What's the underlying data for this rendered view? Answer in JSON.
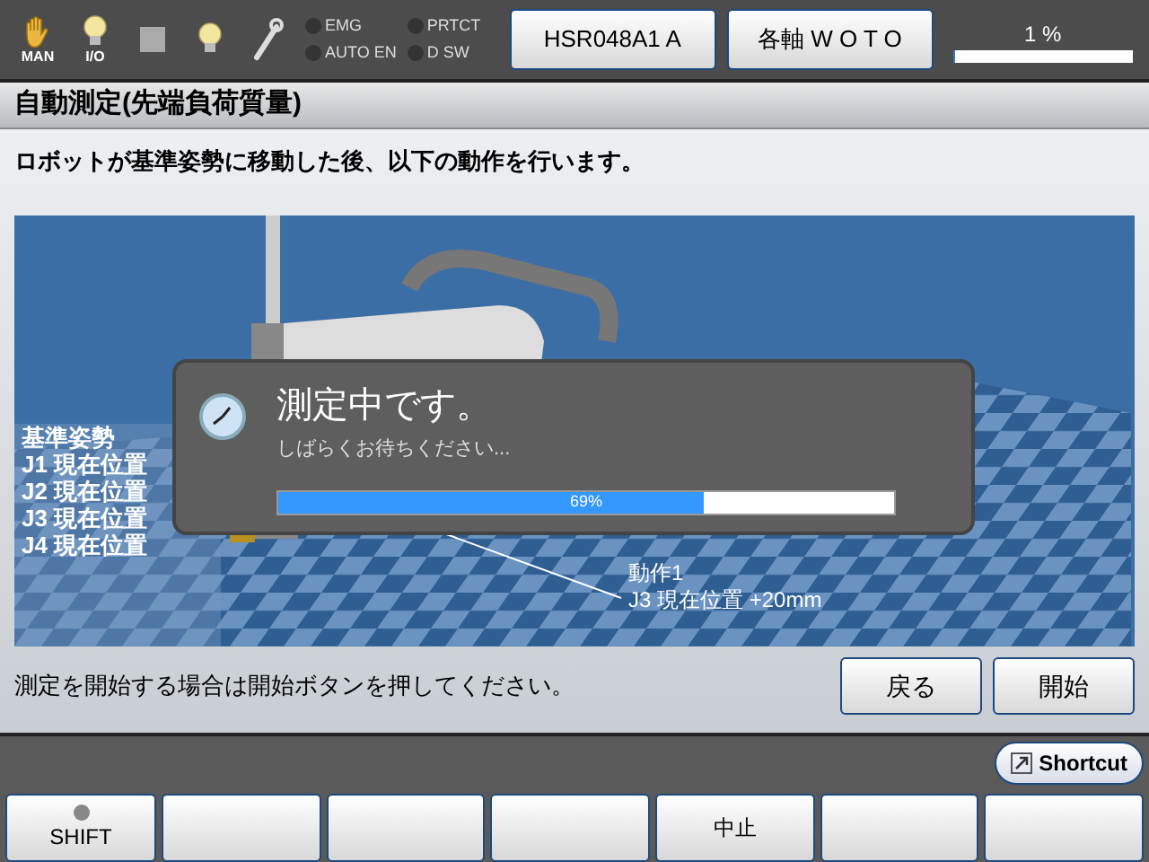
{
  "top_bar": {
    "mode_icons": [
      {
        "kind": "hand",
        "label": "MAN"
      },
      {
        "kind": "bulb",
        "label": "I/O"
      },
      {
        "kind": "square"
      },
      {
        "kind": "bulb"
      },
      {
        "kind": "wrench"
      }
    ],
    "indicators": [
      {
        "label": "EMG",
        "on": false
      },
      {
        "label": "PRTCT",
        "on": false
      },
      {
        "label": "AUTO EN",
        "on": false
      },
      {
        "label": "D SW",
        "on": false
      }
    ],
    "buttons": [
      "HSR048A1 A",
      "各軸 W O T O"
    ],
    "speed": {
      "reading": "1 %",
      "level": 0.01
    }
  },
  "title": "自動測定(先端負荷質量)",
  "instruction": "ロボットが基準姿勢に移動した後、以下の動作を行います。",
  "scene": {
    "pose_lines": [
      "基準姿勢",
      "J1 現在位置",
      "J2 現在位置",
      "J3 現在位置",
      "J4 現在位置"
    ],
    "action_lines": [
      "動作1",
      "J3 現在位置 +20mm"
    ]
  },
  "dialog": {
    "title": "測定中です。",
    "message": "しばらくお待ちください...",
    "progress": {
      "reading": "69%",
      "level": 0.69
    }
  },
  "hint": "測定を開始する場合は開始ボタンを押してください。",
  "actions": [
    "戻る",
    "開始"
  ],
  "shortcut": "Shortcut",
  "function_keys": [
    {
      "kind": "lamp",
      "label": "SHIFT",
      "on": false
    },
    {
      "kind": "blank"
    },
    {
      "kind": "blank"
    },
    {
      "kind": "blank"
    },
    {
      "kind": "text",
      "label": "中止"
    },
    {
      "kind": "blank"
    },
    {
      "kind": "blank"
    }
  ]
}
